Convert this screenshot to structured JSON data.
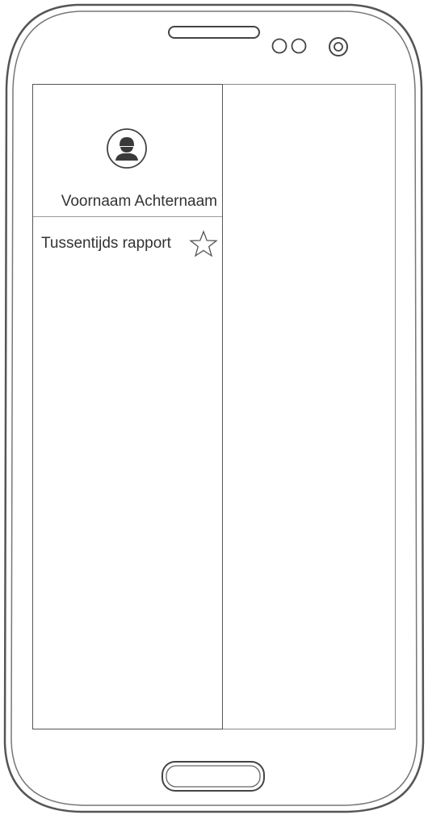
{
  "drawer": {
    "user_name": "Voornaam Achternaam",
    "menu_items": [
      {
        "label": "Tussentijds rapport",
        "icon": "star-icon"
      }
    ]
  },
  "icons": {
    "avatar": "user-avatar-icon",
    "favorite": "star-icon",
    "earpiece": "speaker-grille",
    "sensor": "proximity-sensor",
    "camera": "front-camera",
    "home": "home-button"
  }
}
